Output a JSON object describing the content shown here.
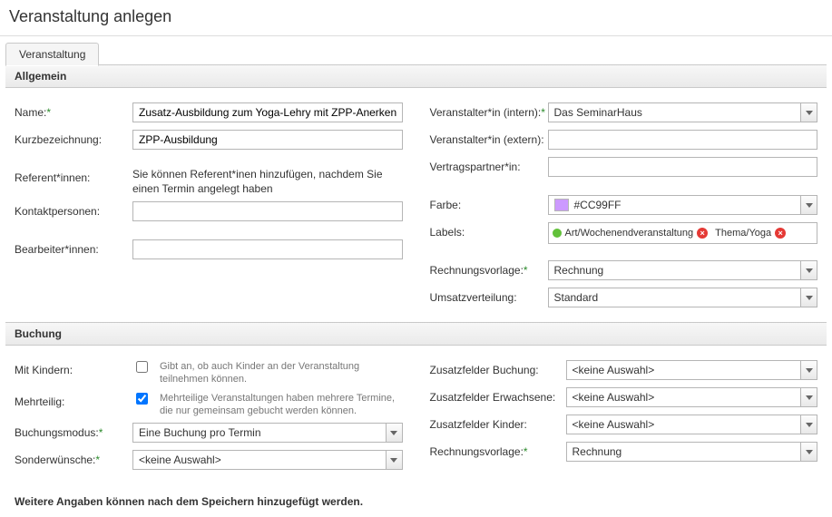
{
  "page_title": "Veranstaltung anlegen",
  "tab": "Veranstaltung",
  "sections": {
    "allgemein": "Allgemein",
    "buchung": "Buchung"
  },
  "allgemein": {
    "labels": {
      "name": "Name:",
      "kurz": "Kurzbezeichnung:",
      "referent": "Referent*innen:",
      "kontakt": "Kontaktpersonen:",
      "bearbeiter": "Bearbeiter*innen:",
      "ver_int": "Veranstalter*in (intern):",
      "ver_ext": "Veranstalter*in (extern):",
      "vertrag": "Vertragspartner*in:",
      "farbe": "Farbe:",
      "labels_f": "Labels:",
      "rechvorl": "Rechnungsvorlage:",
      "umsatz": "Umsatzverteilung:"
    },
    "name": "Zusatz-Ausbildung zum Yoga-Lehry mit ZPP-Anerkennung",
    "kurz": "ZPP-Ausbildung",
    "referent_hint": "Sie können Referent*inen hinzufügen, nachdem Sie einen Termin angelegt haben",
    "kontakt": "",
    "bearbeiter": "",
    "ver_int": "Das SeminarHaus",
    "ver_ext": "",
    "vertrag": "",
    "farbe": "#CC99FF",
    "label_tags": [
      {
        "color": "green",
        "text": "Art/Wochenendveranstaltung"
      },
      {
        "color": "none",
        "text": "Thema/Yoga"
      }
    ],
    "rechvorl": "Rechnung",
    "umsatz": "Standard"
  },
  "buchung": {
    "labels": {
      "kinder": "Mit Kindern:",
      "mehrteilig": "Mehrteilig:",
      "modus": "Buchungsmodus:",
      "sonder": "Sonderwünsche:",
      "zf_buchung": "Zusatzfelder Buchung:",
      "zf_erw": "Zusatzfelder Erwachsene:",
      "zf_kind": "Zusatzfelder Kinder:",
      "rechvorl": "Rechnungsvorlage:"
    },
    "kinder_hint": "Gibt an, ob auch Kinder an der Veranstaltung teilnehmen können.",
    "kinder_checked": false,
    "mehrteilig_hint": "Mehrteilige Veranstaltungen haben mehrere Termine, die nur gemeinsam gebucht werden können.",
    "mehrteilig_checked": true,
    "modus": "Eine Buchung pro Termin",
    "sonder": "<keine Auswahl>",
    "zf_buchung": "<keine Auswahl>",
    "zf_erw": "<keine Auswahl>",
    "zf_kind": "<keine Auswahl>",
    "rechvorl": "Rechnung"
  },
  "footer": "Weitere Angaben können nach dem Speichern hinzugefügt werden."
}
